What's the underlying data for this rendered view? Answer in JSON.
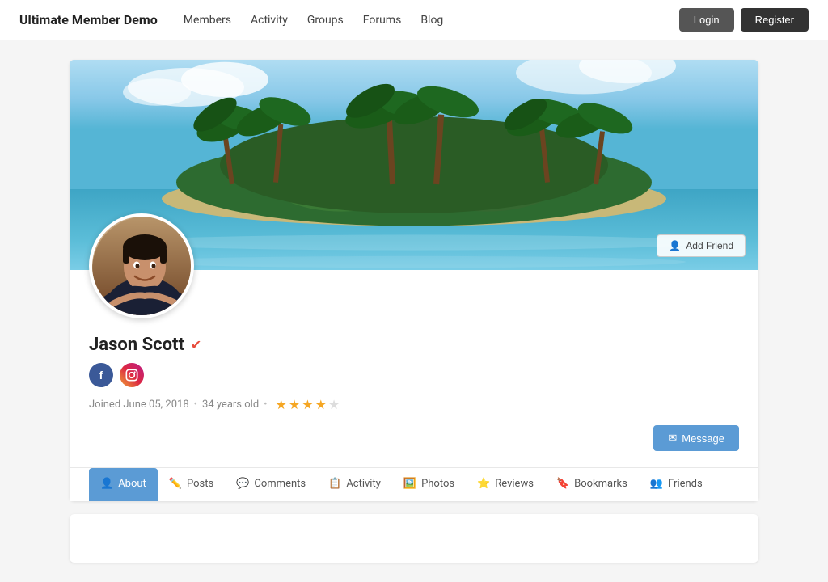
{
  "header": {
    "site_title": "Ultimate Member Demo",
    "nav": [
      {
        "label": "Members",
        "href": "#"
      },
      {
        "label": "Activity",
        "href": "#"
      },
      {
        "label": "Groups",
        "href": "#"
      },
      {
        "label": "Forums",
        "href": "#"
      },
      {
        "label": "Blog",
        "href": "#"
      }
    ],
    "login_label": "Login",
    "register_label": "Register"
  },
  "profile": {
    "name": "Jason Scott",
    "verified": true,
    "joined": "Joined June 05, 2018",
    "age": "34 years old",
    "rating": 3.5,
    "total_stars": 5,
    "add_friend_label": "Add Friend",
    "message_label": "Message",
    "social": [
      {
        "name": "facebook",
        "label": "f"
      },
      {
        "name": "instagram",
        "label": "📷"
      }
    ]
  },
  "tabs": [
    {
      "label": "About",
      "icon": "👤",
      "active": true
    },
    {
      "label": "Posts",
      "icon": "✏️",
      "active": false
    },
    {
      "label": "Comments",
      "icon": "💬",
      "active": false
    },
    {
      "label": "Activity",
      "icon": "📋",
      "active": false
    },
    {
      "label": "Photos",
      "icon": "🖼️",
      "active": false
    },
    {
      "label": "Reviews",
      "icon": "⭐",
      "active": false
    },
    {
      "label": "Bookmarks",
      "icon": "🔖",
      "active": false
    },
    {
      "label": "Friends",
      "icon": "👥",
      "active": false
    }
  ],
  "icons": {
    "verified": "✔",
    "add_friend": "👤",
    "message": "✉"
  }
}
